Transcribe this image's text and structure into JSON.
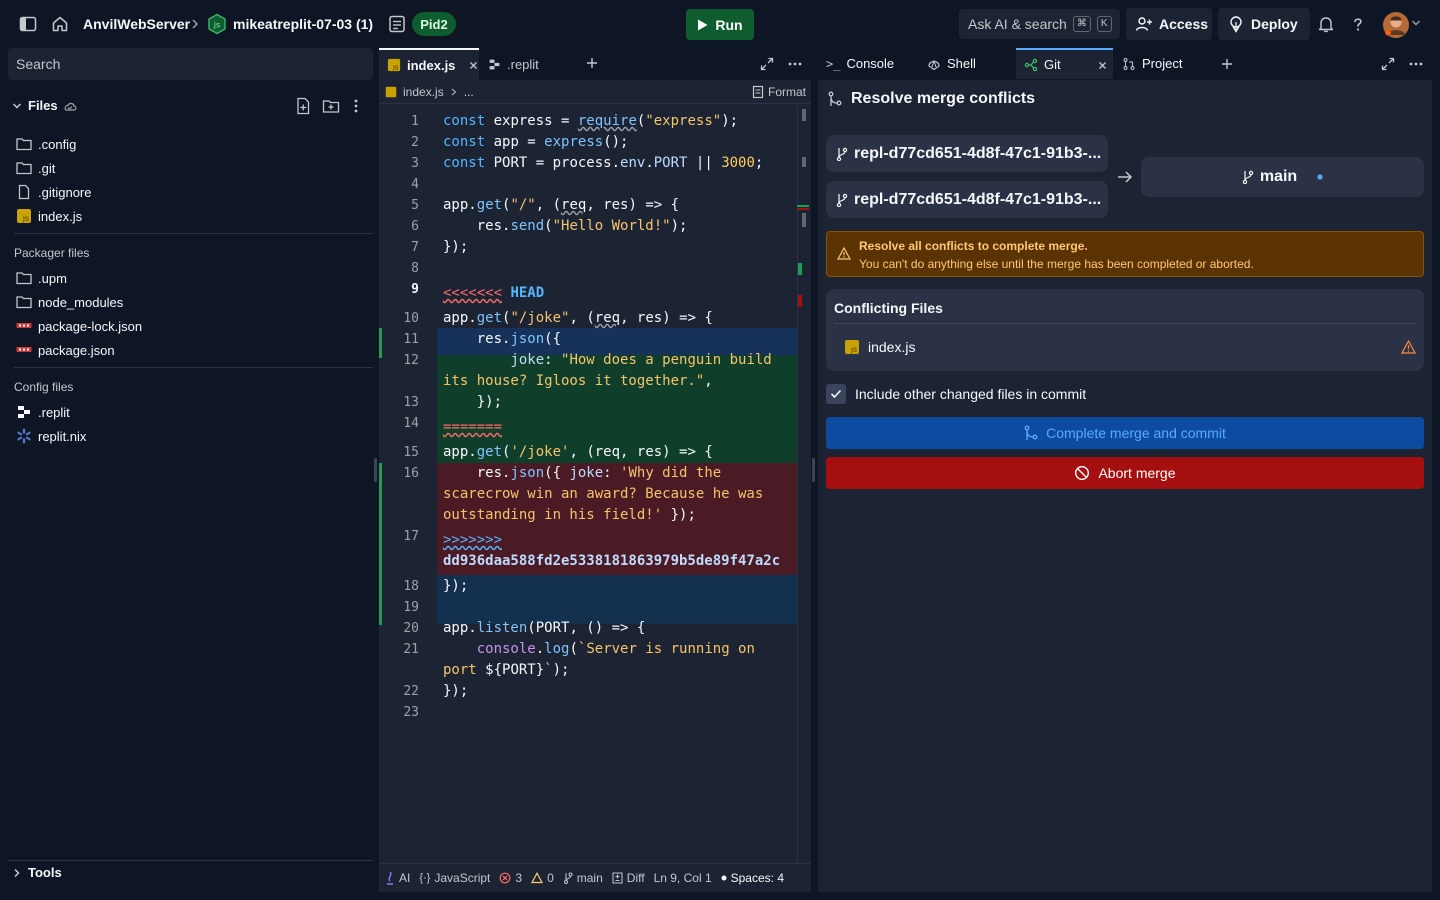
{
  "topbar": {
    "app_name": "AnvilWebServer",
    "repl_name": "mikeatreplit-07-03 (1)",
    "pid_badge": "Pid2",
    "run_label": "Run",
    "search_label": "Ask AI & search",
    "search_kbd_1": "⌘",
    "search_kbd_2": "K",
    "access_label": "Access",
    "deploy_label": "Deploy"
  },
  "sidebar": {
    "search_placeholder": "Search",
    "files_header": "Files",
    "files": [
      {
        "name": ".config",
        "icon": "folder-icon"
      },
      {
        "name": ".git",
        "icon": "folder-icon"
      },
      {
        "name": ".gitignore",
        "icon": "file-icon"
      },
      {
        "name": "index.js",
        "icon": "js-file-icon"
      }
    ],
    "packager_title": "Packager files",
    "packager_files": [
      {
        "name": ".upm",
        "icon": "folder-icon"
      },
      {
        "name": "node_modules",
        "icon": "folder-icon"
      },
      {
        "name": "package-lock.json",
        "icon": "npm-icon"
      },
      {
        "name": "package.json",
        "icon": "npm-icon"
      }
    ],
    "config_title": "Config files",
    "config_files": [
      {
        "name": ".replit",
        "icon": "replit-icon"
      },
      {
        "name": "replit.nix",
        "icon": "nix-icon"
      }
    ],
    "tools_label": "Tools"
  },
  "editor": {
    "tabs": [
      {
        "label": "index.js",
        "active": true
      },
      {
        "label": ".replit",
        "active": false
      }
    ],
    "breadcrumb_file": "index.js",
    "breadcrumb_more": "...",
    "format_label": "Format",
    "line_numbers": [
      "1",
      "2",
      "3",
      "4",
      "5",
      "6",
      "7",
      "8",
      "9",
      "10",
      "11",
      "12",
      "13",
      "14",
      "15",
      "16",
      "17",
      "18",
      "19",
      "20",
      "21",
      "22",
      "23"
    ],
    "active_line": "9",
    "status": {
      "ai": "AI",
      "language": "JavaScript",
      "errors": "3",
      "warnings": "0",
      "branch": "main",
      "diff": "Diff",
      "cursor": "Ln 9, Col 1",
      "spaces": "Spaces: 4"
    }
  },
  "git": {
    "tabs": [
      {
        "label": "Console",
        "icon": "console-icon"
      },
      {
        "label": "Shell",
        "icon": "shell-icon"
      },
      {
        "label": "Git",
        "icon": "git-icon"
      },
      {
        "label": "Project",
        "icon": "project-icon"
      }
    ],
    "title": "Resolve merge conflicts",
    "source_branch_1": "repl-d77cd651-4d8f-47c1-91b3-...",
    "source_branch_2": "repl-d77cd651-4d8f-47c1-91b3-...",
    "target_branch": "main",
    "warning_title": "Resolve all conflicts to complete merge.",
    "warning_body": "You can't do anything else until the merge has been completed or aborted.",
    "conflicting_title": "Conflicting Files",
    "conflicting_files": [
      "index.js"
    ],
    "include_label": "Include other changed files in commit",
    "include_checked": true,
    "complete_label": "Complete merge and commit",
    "abort_label": "Abort merge"
  },
  "colors": {
    "run_green": "#0f5c2e",
    "warning_orange": "#ffc874",
    "complete_blue": "#0d4ba0",
    "abort_red": "#a60f0f"
  }
}
